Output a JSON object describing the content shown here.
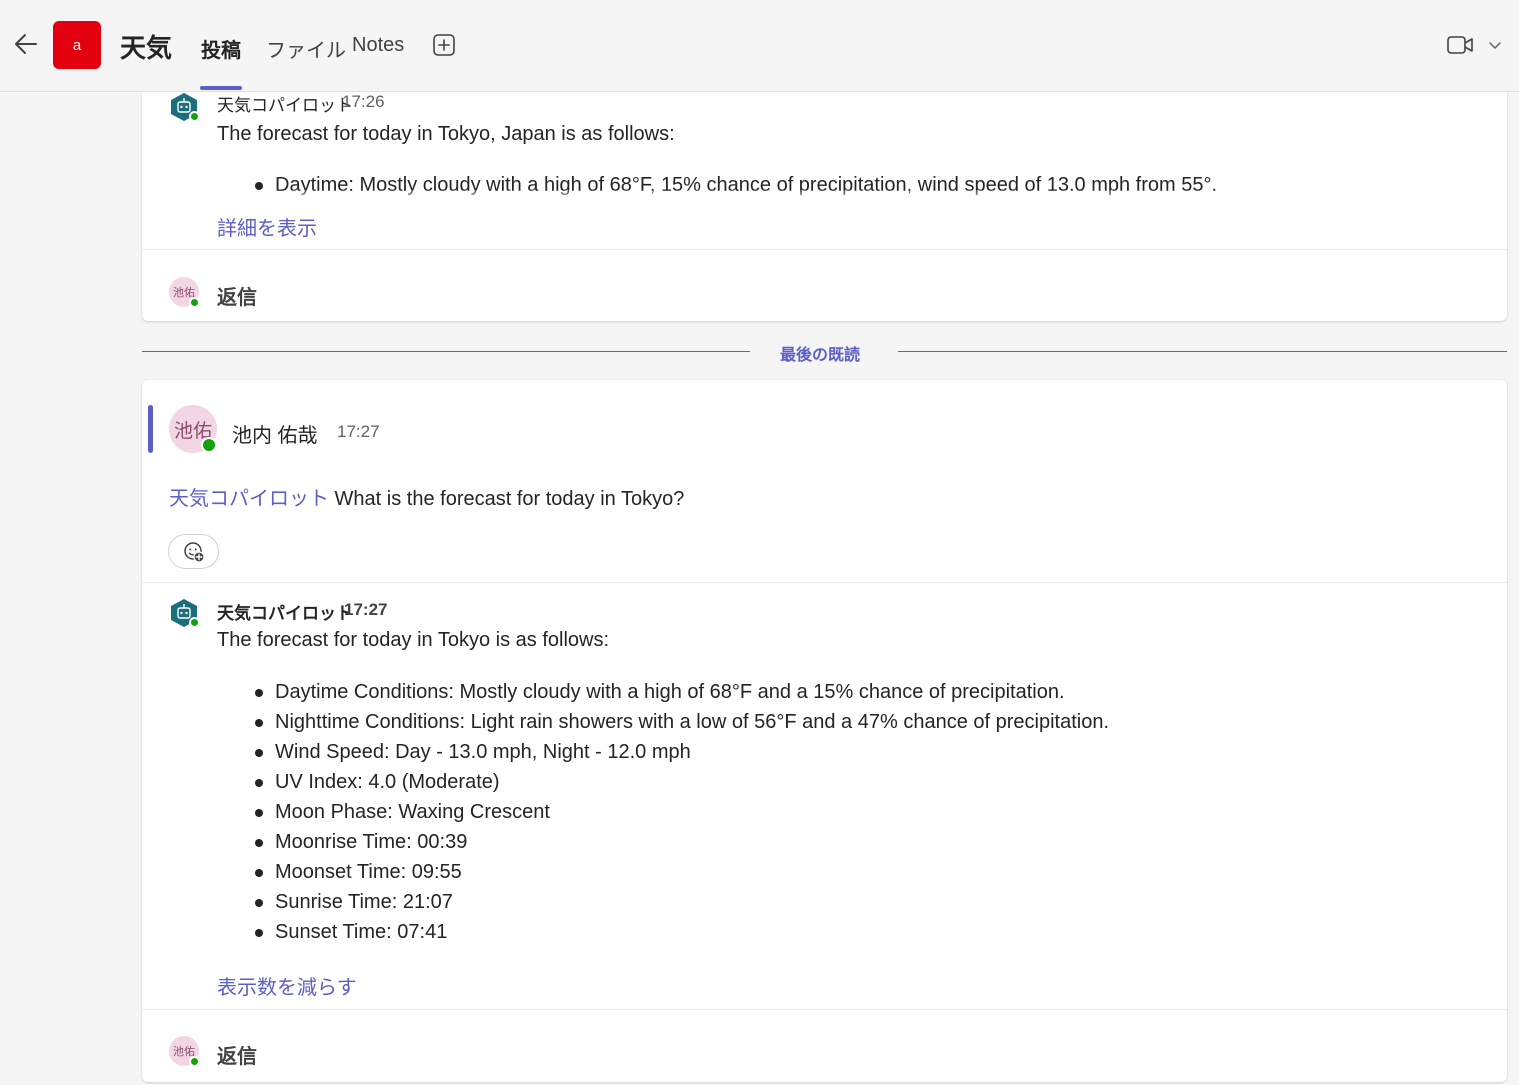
{
  "header": {
    "team_avatar_letter": "a",
    "team_avatar_color": "#e3000f",
    "channel_title": "天気",
    "tabs": [
      {
        "label": "投稿",
        "active": true
      },
      {
        "label": "ファイル",
        "active": false
      },
      {
        "label": "Notes",
        "active": false
      }
    ],
    "accent_color": "#5b5fc7"
  },
  "thread1": {
    "bot_name": "天気コパイロット",
    "time": "17:26",
    "intro": "The forecast for today in Tokyo, Japan is as follows:",
    "bullets": [
      "Daytime: Mostly cloudy with a high of 68°F, 15% chance of precipitation, wind speed of 13.0 mph from 55°."
    ],
    "show_more": "詳細を表示",
    "reply_avatar": "池佑",
    "reply_label": "返信"
  },
  "last_read": "最後の既読",
  "thread2": {
    "user_avatar": "池佑",
    "user_name": "池内 佑哉",
    "time": "17:27",
    "mention": "天気コパイロット",
    "question": " What is the forecast for today in Tokyo?",
    "reply": {
      "bot_name": "天気コパイロット",
      "time": "17:27",
      "intro": "The forecast for today in Tokyo is as follows:",
      "bullets": [
        "Daytime Conditions: Mostly cloudy with a high of 68°F and a 15% chance of precipitation.",
        "Nighttime Conditions: Light rain showers with a low of 56°F and a 47% chance of precipitation.",
        "Wind Speed: Day - 13.0 mph, Night - 12.0 mph",
        "UV Index: 4.0 (Moderate)",
        "Moon Phase: Waxing Crescent",
        "Moonrise Time: 00:39",
        "Moonset Time: 09:55",
        "Sunrise Time: 21:07",
        "Sunset Time: 07:41"
      ],
      "show_less": "表示数を減らす"
    },
    "reply_avatar": "池佑",
    "reply_label": "返信"
  }
}
